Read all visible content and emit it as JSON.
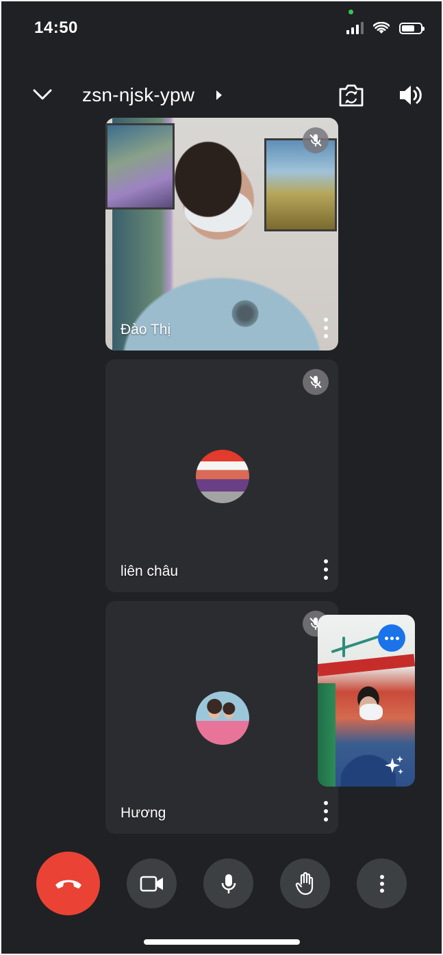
{
  "status_bar": {
    "time": "14:50"
  },
  "top_bar": {
    "meeting_code": "zsn-njsk-ypw"
  },
  "participants": [
    {
      "name": "Đào Thị",
      "muted": true,
      "video": true
    },
    {
      "name": "liên châu",
      "muted": true,
      "video": false
    },
    {
      "name": "Hương",
      "muted": true,
      "video": false
    }
  ],
  "icons": {
    "collapse": "chevron-down-icon",
    "code_arrow": "caret-right-icon",
    "flip_camera": "flip-camera-icon",
    "speaker": "speaker-icon",
    "mic_off": "mic-off-icon",
    "more": "more-vert-icon",
    "end_call": "end-call-icon",
    "camera": "video-camera-icon",
    "mic": "mic-icon",
    "raise_hand": "raise-hand-icon",
    "effects": "sparkle-icon"
  },
  "colors": {
    "end_call": "#ea4335",
    "accent": "#1a73e8",
    "background": "#202124",
    "tile": "#2b2c30"
  }
}
